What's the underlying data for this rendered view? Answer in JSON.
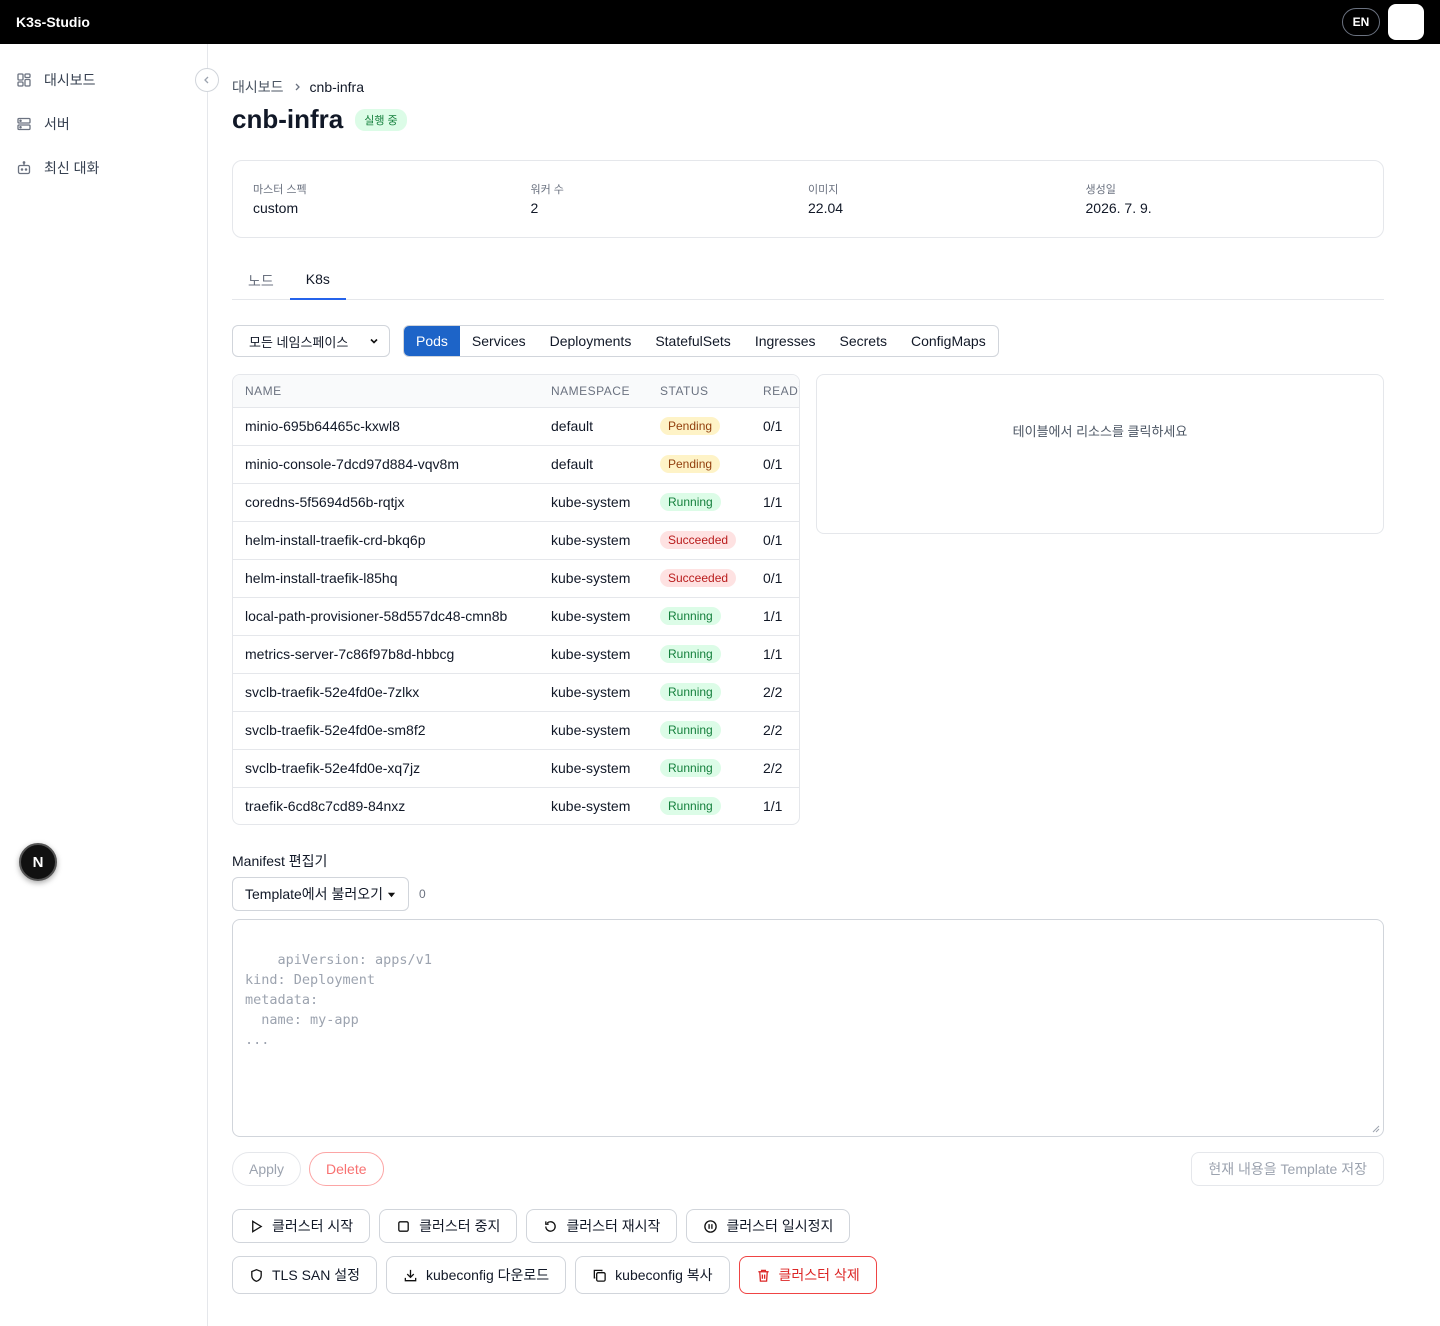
{
  "app": {
    "brand": "K3s-Studio",
    "lang": "EN"
  },
  "sidebar": {
    "items": [
      {
        "label": "대시보드",
        "icon": "dashboard-icon"
      },
      {
        "label": "서버",
        "icon": "server-icon"
      },
      {
        "label": "최신 대화",
        "icon": "bot-icon"
      }
    ],
    "floating_badge": "N"
  },
  "breadcrumb": {
    "parent": "대시보드",
    "current": "cnb-infra"
  },
  "header": {
    "title": "cnb-infra",
    "status": "실행 중"
  },
  "info": [
    {
      "label": "마스터 스펙",
      "value": "custom"
    },
    {
      "label": "워커 수",
      "value": "2"
    },
    {
      "label": "이미지",
      "value": "22.04"
    },
    {
      "label": "생성일",
      "value": "2026. 7. 9."
    }
  ],
  "tabs": [
    "노드",
    "K8s"
  ],
  "active_tab": "K8s",
  "namespace_select": {
    "value": "모든 네임스페이스"
  },
  "resource_tabs": [
    "Pods",
    "Services",
    "Deployments",
    "StatefulSets",
    "Ingresses",
    "Secrets",
    "ConfigMaps"
  ],
  "active_resource": "Pods",
  "table": {
    "headers": [
      "NAME",
      "NAMESPACE",
      "STATUS",
      "READY"
    ],
    "rows": [
      {
        "name": "minio-695b64465c-kxwl8",
        "namespace": "default",
        "status": "Pending",
        "ready": "0/1"
      },
      {
        "name": "minio-console-7dcd97d884-vqv8m",
        "namespace": "default",
        "status": "Pending",
        "ready": "0/1"
      },
      {
        "name": "coredns-5f5694d56b-rqtjx",
        "namespace": "kube-system",
        "status": "Running",
        "ready": "1/1"
      },
      {
        "name": "helm-install-traefik-crd-bkq6p",
        "namespace": "kube-system",
        "status": "Succeeded",
        "ready": "0/1"
      },
      {
        "name": "helm-install-traefik-l85hq",
        "namespace": "kube-system",
        "status": "Succeeded",
        "ready": "0/1"
      },
      {
        "name": "local-path-provisioner-58d557dc48-cmn8b",
        "namespace": "kube-system",
        "status": "Running",
        "ready": "1/1"
      },
      {
        "name": "metrics-server-7c86f97b8d-hbbcg",
        "namespace": "kube-system",
        "status": "Running",
        "ready": "1/1"
      },
      {
        "name": "svclb-traefik-52e4fd0e-7zlkx",
        "namespace": "kube-system",
        "status": "Running",
        "ready": "2/2"
      },
      {
        "name": "svclb-traefik-52e4fd0e-sm8f2",
        "namespace": "kube-system",
        "status": "Running",
        "ready": "2/2"
      },
      {
        "name": "svclb-traefik-52e4fd0e-xq7jz",
        "namespace": "kube-system",
        "status": "Running",
        "ready": "2/2"
      },
      {
        "name": "traefik-6cd8c7cd89-84nxz",
        "namespace": "kube-system",
        "status": "Running",
        "ready": "1/1"
      }
    ]
  },
  "detail_panel": {
    "placeholder": "테이블에서 리소스를 클릭하세요"
  },
  "manifest": {
    "label": "Manifest 편집기",
    "template_button": "Template에서 불러오기",
    "template_count": "0",
    "placeholder": "apiVersion: apps/v1\nkind: Deployment\nmetadata:\n  name: my-app\n..."
  },
  "actions": {
    "apply": "Apply",
    "delete": "Delete",
    "save_template": "현재 내용을 Template 저장"
  },
  "cluster_controls": [
    {
      "label": "클러스터 시작",
      "icon": "play-icon"
    },
    {
      "label": "클러스터 중지",
      "icon": "stop-icon"
    },
    {
      "label": "클러스터 재시작",
      "icon": "restart-icon"
    },
    {
      "label": "클러스터 일시정지",
      "icon": "pause-icon"
    }
  ],
  "cluster_utils": [
    {
      "label": "TLS SAN 설정",
      "icon": "shield-icon"
    },
    {
      "label": "kubeconfig 다운로드",
      "icon": "download-icon"
    },
    {
      "label": "kubeconfig 복사",
      "icon": "copy-icon"
    },
    {
      "label": "클러스터 삭제",
      "icon": "trash-icon"
    }
  ],
  "colors": {
    "accent": "#1d64c8",
    "danger": "#dc2626",
    "running": "#15803d",
    "pending": "#92400e"
  }
}
